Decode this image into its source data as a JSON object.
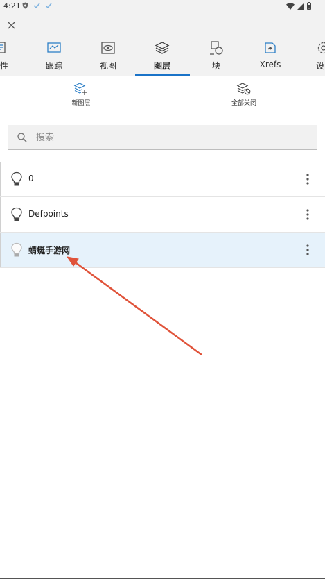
{
  "status": {
    "time": "4:21",
    "left_icons": [
      "shield-icon",
      "check-icon",
      "check-icon"
    ],
    "right_icons": [
      "wifi-icon",
      "signal-icon",
      "battery-icon"
    ]
  },
  "toolbar": {
    "close_icon": "close-icon"
  },
  "tabs": [
    {
      "label": "性",
      "icon": "properties-icon"
    },
    {
      "label": "跟踪",
      "icon": "trace-icon"
    },
    {
      "label": "视图",
      "icon": "view-icon"
    },
    {
      "label": "图层",
      "icon": "layers-icon",
      "active": true
    },
    {
      "label": "块",
      "icon": "block-icon"
    },
    {
      "label": "Xrefs",
      "icon": "xrefs-icon"
    },
    {
      "label": "设",
      "icon": "settings-icon"
    }
  ],
  "actions": {
    "new_layer": "新图层",
    "all_off": "全部关闭"
  },
  "search": {
    "placeholder": "搜索",
    "value": ""
  },
  "layers": [
    {
      "name": "0",
      "selected": false
    },
    {
      "name": "Defpoints",
      "selected": false
    },
    {
      "name": "蜻蜓手游网",
      "selected": true
    }
  ],
  "colors": {
    "accent": "#1a73c8",
    "annotation_arrow": "#e0533a",
    "selected_row": "#e6f2fb"
  }
}
